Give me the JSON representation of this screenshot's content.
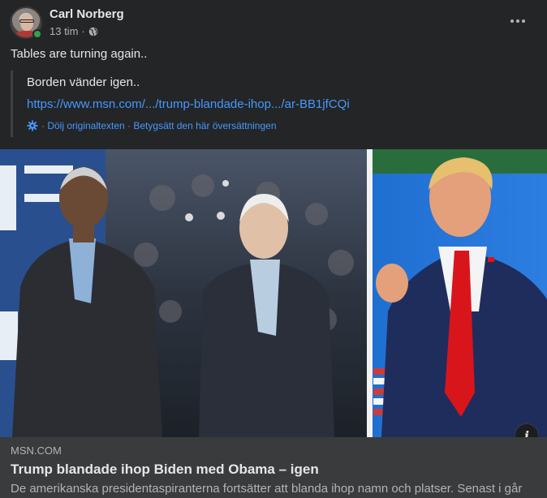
{
  "post": {
    "author": "Carl Norberg",
    "time": "13 tim",
    "separator": "·",
    "text": "Tables are turning again..",
    "more_icon": "more-horizontal-icon",
    "audience_icon": "globe-icon"
  },
  "translation": {
    "text": "Borden vänder igen..",
    "link": "https://www.msn.com/.../trump-blandade-ihop.../ar-BB1jfCQi",
    "actions": "· Dölj originaltexten · Betygsätt den här översättningen",
    "icon": "gear-icon"
  },
  "link_preview": {
    "domain": "MSN.COM",
    "title": "Trump blandade ihop Biden med Obama – igen",
    "description": "De amerikanska presidentaspiranterna fortsätter att blanda ihop namn och platser. Senast i går",
    "info_label": "i"
  },
  "colors": {
    "background": "#242526",
    "card": "#3a3b3c",
    "link": "#4599ff",
    "online": "#31a24c"
  }
}
